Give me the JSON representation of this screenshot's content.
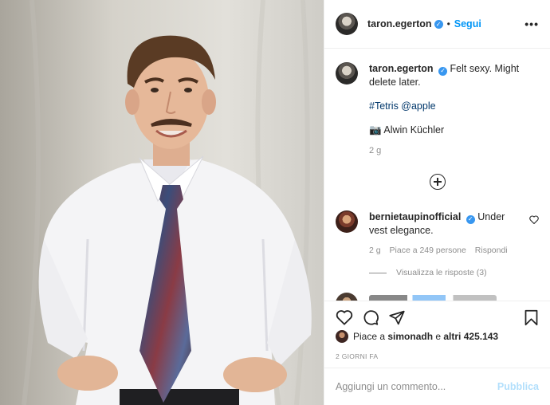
{
  "post": {
    "username": "taron.egerton",
    "follow_label": "Segui",
    "more_label": "•••",
    "caption_text": "Felt sexy. Might delete later.",
    "hashtags": "#Tetris @apple",
    "camera_emoji": "📷",
    "photo_credit": "Alwin Küchler",
    "caption_age": "2 g"
  },
  "comment": {
    "username": "bernietaupinofficial",
    "text": "Under vest elegance.",
    "age": "2 g",
    "likes": "Piace a 249 persone",
    "reply_label": "Rispondi",
    "view_replies": "Visualizza le risposte (3)"
  },
  "likes_line": {
    "prefix": "Piace a ",
    "user": "simonadh",
    "middle": " e ",
    "others": "altri 425.143"
  },
  "timestamp": "2 GIORNI FA",
  "composer": {
    "placeholder": "Aggiungi un commento...",
    "post_label": "Pubblica"
  },
  "colors": {
    "accent": "#0095f6",
    "verified": "#3897f0",
    "post_disabled": "#b2dffc",
    "muted": "#8e8e8e"
  }
}
